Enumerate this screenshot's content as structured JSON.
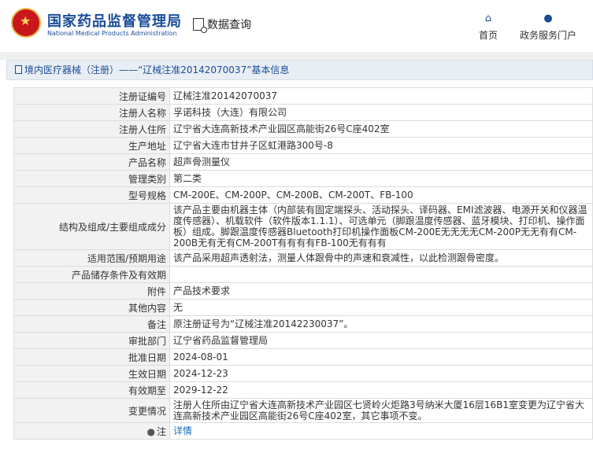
{
  "header": {
    "site_name_cn": "国家药品监督管理局",
    "site_name_en": "National Medical Products Administration",
    "query_label": "数据查询",
    "nav_home": "首页",
    "nav_portal": "政务服务门户"
  },
  "breadcrumb": {
    "text": "境内医疗器械（注册）——“辽械注准20142070037”基本信息"
  },
  "rows": [
    {
      "key": "注册证编号",
      "value": "辽械注准20142070037"
    },
    {
      "key": "注册人名称",
      "value": "孚诺科技（大连）有限公司"
    },
    {
      "key": "注册人住所",
      "value": "辽宁省大连高新技术产业园区高能街26号C座402室"
    },
    {
      "key": "生产地址",
      "value": "辽宁省大连市甘井子区虹港路300号-8"
    },
    {
      "key": "产品名称",
      "value": "超声骨测量仪"
    },
    {
      "key": "管理类别",
      "value": "第二类"
    },
    {
      "key": "型号规格",
      "value": "CM-200E、CM-200P、CM-200B、CM-200T、FB-100"
    },
    {
      "key": "结构及组成/主要组成成分",
      "value": "该产品主要由机器主体（内部装有固定端探头、活动探头、译码器、EMI滤波器、电源开关和仪器温度传感器）、机载软件（软件版本1.1.1）、可选单元（脚跟温度传感器、蓝牙模块、打印机、操作面板）组成。脚跟温度传感器Bluetooth打印机操作面板CM-200E无无无无CM-200P无无有有CM-200B无有无有CM-200T有有有有FB-100无有有有"
    },
    {
      "key": "适用范围/预期用途",
      "value": "该产品采用超声透射法，测量人体跟骨中的声速和衰减性，以此检测跟骨密度。"
    },
    {
      "key": "产品储存条件及有效期",
      "value": ""
    },
    {
      "key": "附件",
      "value": "产品技术要求"
    },
    {
      "key": "其他内容",
      "value": "无"
    },
    {
      "key": "备注",
      "value": "原注册证号为“辽械注准20142230037”。"
    },
    {
      "key": "审批部门",
      "value": "辽宁省药品监督管理局"
    },
    {
      "key": "批准日期",
      "value": "2024-08-01"
    },
    {
      "key": "生效日期",
      "value": "2024-12-23"
    },
    {
      "key": "有效期至",
      "value": "2029-12-22"
    },
    {
      "key": "变更情况",
      "value": "注册人住所由辽宁省大连高新技术产业园区七贤岭火炬路3号纳米大厦16层16B1室变更为辽宁省大连高新技术产业园区高能街26号C座402室，其它事项不变。"
    }
  ],
  "note": {
    "key": "注",
    "link": "详情",
    "icon": "lightbulb-icon"
  }
}
